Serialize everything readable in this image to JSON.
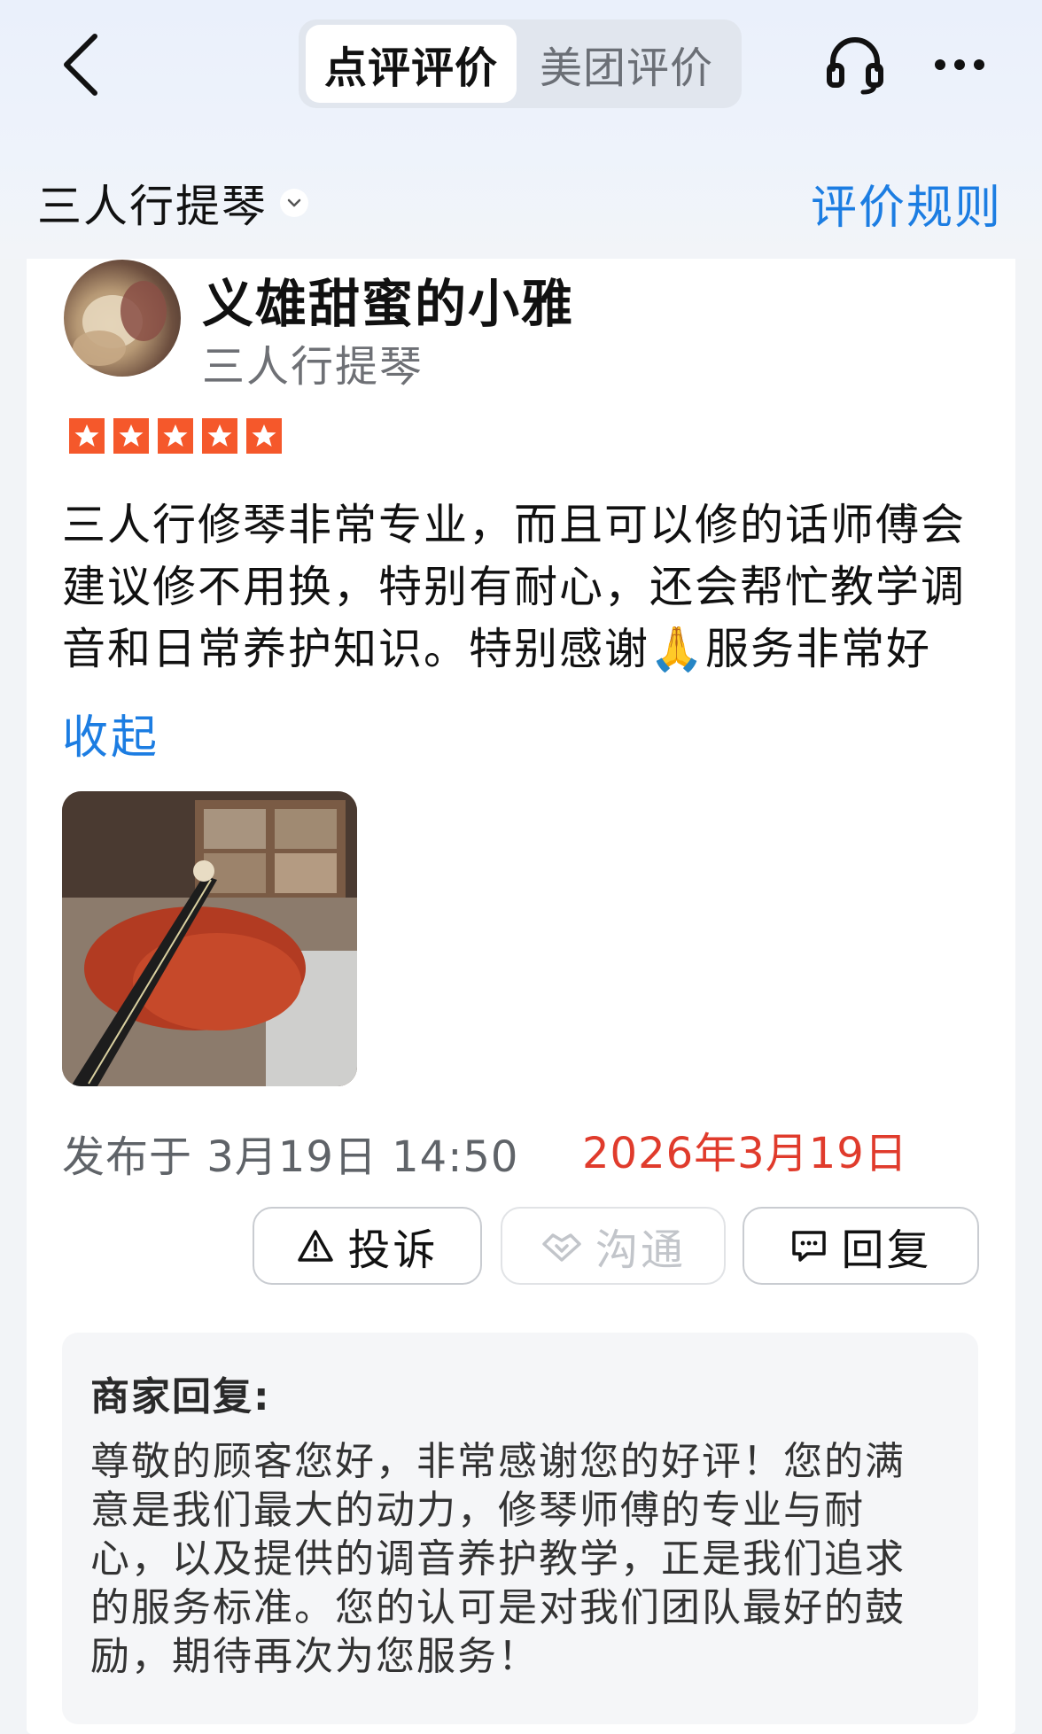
{
  "header": {
    "tabs": [
      {
        "label": "点评评价",
        "active": true
      },
      {
        "label": "美团评价",
        "active": false
      }
    ],
    "shop_name": "三人行提琴",
    "rules_link": "评价规则"
  },
  "icons": {
    "back": "chevron-left-icon",
    "support": "headset-icon",
    "more": "more-dots-icon",
    "shop_dropdown": "chevron-down-icon",
    "report": "warning-triangle-icon",
    "chat": "handshake-icon",
    "reply": "message-bubble-icon"
  },
  "review": {
    "user_name": "义雄甜蜜的小雅",
    "user_sub": "三人行提琴",
    "rating": 5,
    "text": "三人行修琴非常专业，而且可以修的话师傅会建议修不用换，特别有耐心，还会帮忙教学调音和日常养护知识。特别感谢🙏服务非常好",
    "collapse_label": "收起",
    "published": "发布于 3月19日 14:50",
    "date_red": "2026年3月19日"
  },
  "actions": {
    "report_label": "投诉",
    "chat_label": "沟通",
    "reply_label": "回复"
  },
  "merchant_reply": {
    "title": "商家回复:",
    "text": "尊敬的顾客您好，非常感谢您的好评！您的满意是我们最大的动力，修琴师傅的专业与耐心，以及提供的调音养护教学，正是我们追求的服务标准。您的认可是对我们团队最好的鼓励，期待再次为您服务！"
  },
  "colors": {
    "accent_blue": "#1c7de2",
    "star_orange": "#f5582b",
    "date_red": "#e03b2c",
    "header_bg": "#eaf0fb"
  }
}
